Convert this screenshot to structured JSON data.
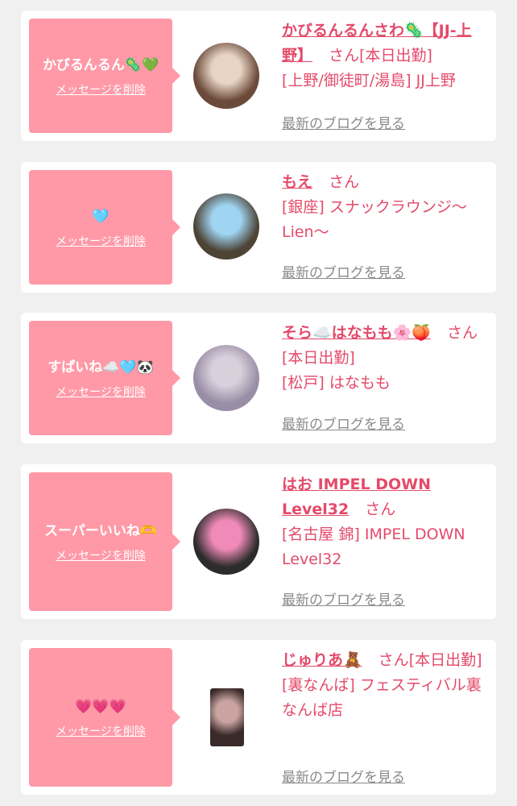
{
  "delete_label": "メッセージを削除",
  "blog_label": "最新のブログを見る",
  "san_suffix": "さん",
  "colors": {
    "bubble": "#ff99a7",
    "accent": "#e44a6a",
    "muted": "#8a8a8a",
    "background": "#f0f0f0"
  },
  "messages": [
    {
      "comment": "かびるんるん🦠💚",
      "name": "かびるんるんさわ🦠【JJ-上野】",
      "status": "[本日出勤]",
      "shop": "[上野/御徒町/湯島] JJ上野",
      "avatar_colors": [
        "#6b4a3a",
        "#e8d4c4"
      ]
    },
    {
      "comment": "🩵",
      "name": "もえ",
      "status": "",
      "shop": "[銀座] スナックラウンジ〜Lien〜",
      "avatar_colors": [
        "#4d4436",
        "#9fd4f2"
      ]
    },
    {
      "comment": "すぱいね☁️🩵🐼",
      "name": "そら☁️はなもも🌸🍑",
      "status": "[本日出勤]",
      "shop": "[松戸] はなもも",
      "avatar_colors": [
        "#9a8ea6",
        "#d9d0dc"
      ]
    },
    {
      "comment": "スーパーいいね🫶",
      "name": "はお IMPEL DOWN Level32",
      "status": "",
      "shop": "[名古屋 錦] IMPEL DOWN Level32",
      "avatar_colors": [
        "#2c2c2c",
        "#f08ab8"
      ]
    },
    {
      "comment": "💗💗💗",
      "name": "じゅりあ🧸",
      "status": "[本日出勤]",
      "shop": "[裏なんば] フェスティバル裏なんば店",
      "avatar_colors": [
        "#3a2a2a",
        "#c9a4a0"
      ]
    }
  ]
}
